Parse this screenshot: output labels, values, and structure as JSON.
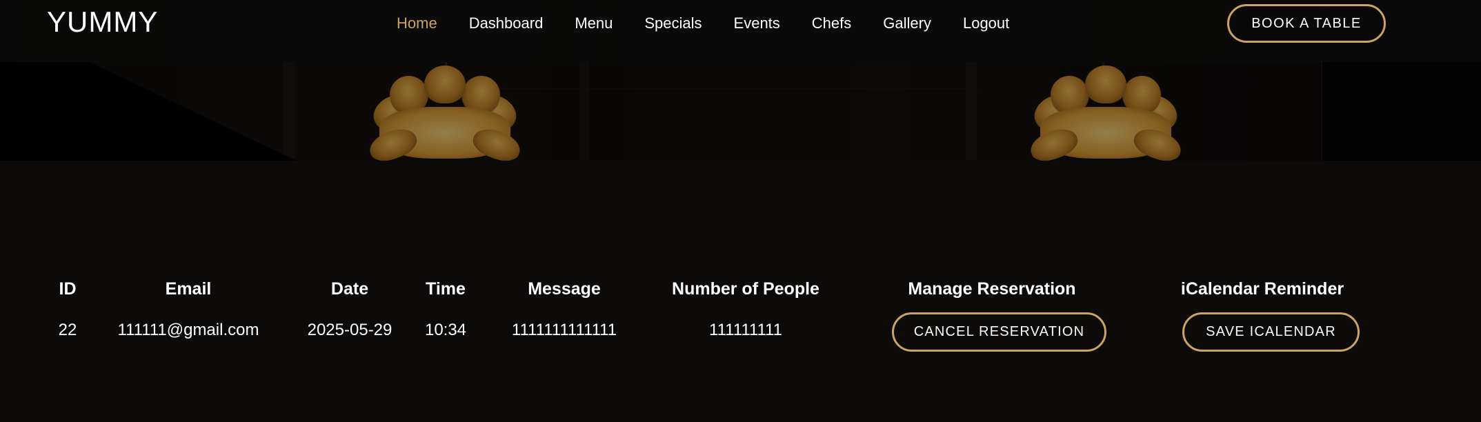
{
  "header": {
    "logo": "YUMMY",
    "nav": [
      {
        "label": "Home",
        "active": true
      },
      {
        "label": "Dashboard",
        "active": false
      },
      {
        "label": "Menu",
        "active": false
      },
      {
        "label": "Specials",
        "active": false
      },
      {
        "label": "Events",
        "active": false
      },
      {
        "label": "Chefs",
        "active": false
      },
      {
        "label": "Gallery",
        "active": false
      },
      {
        "label": "Logout",
        "active": false
      }
    ],
    "book_button": "BOOK A TABLE"
  },
  "reservations": {
    "columns": [
      "ID",
      "Email",
      "Date",
      "Time",
      "Message",
      "Number of People",
      "Manage Reservation",
      "iCalendar Reminder"
    ],
    "rows": [
      {
        "id": "22",
        "email": "111111@gmail.com",
        "date": "2025-05-29",
        "time": "10:34",
        "message": "1111111111111",
        "people": "111111111",
        "cancel_label": "CANCEL RESERVATION",
        "ical_label": "SAVE ICALENDAR"
      }
    ]
  },
  "colors": {
    "accent": "#cda45e",
    "background": "#0c0b09",
    "text": "#ffffff"
  }
}
